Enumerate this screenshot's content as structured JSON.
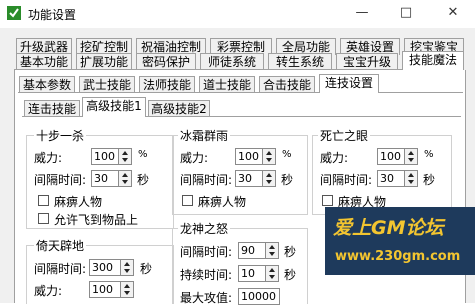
{
  "window": {
    "title": "功能设置",
    "minimize": "—",
    "maximize": "□",
    "close": "✕"
  },
  "tabs_row1": [
    "升级武器",
    "挖矿控制",
    "祝福油控制",
    "彩票控制",
    "全局功能",
    "英雄设置",
    "挖宝鉴宝"
  ],
  "tabs_row2": [
    "基本功能",
    "扩展功能",
    "密码保护",
    "师徒系统",
    "转生系统",
    "宝宝升级",
    "技能魔法"
  ],
  "tabs_row3": [
    "基本参数",
    "武士技能",
    "法师技能",
    "道士技能",
    "合击技能",
    "连技设置"
  ],
  "tabs_row4": [
    "连击技能",
    "高级技能1",
    "高级技能2"
  ],
  "groups": {
    "shibu": {
      "title": "十步一杀",
      "power_label": "威力:",
      "power": "100",
      "power_unit": "%",
      "interval_label": "间隔时间:",
      "interval": "30",
      "interval_unit": "秒",
      "paralyze": "麻痹人物",
      "fly": "允许飞到物品上"
    },
    "bingshuang": {
      "title": "冰霜群雨",
      "power_label": "威力:",
      "power": "100",
      "power_unit": "%",
      "interval_label": "间隔时间:",
      "interval": "30",
      "interval_unit": "秒",
      "paralyze": "麻痹人物"
    },
    "siwang": {
      "title": "死亡之眼",
      "power_label": "威力:",
      "power": "100",
      "power_unit": "%",
      "interval_label": "间隔时间:",
      "interval": "30",
      "interval_unit": "秒",
      "paralyze": "麻痹人物"
    },
    "yitian": {
      "title": "倚天辟地",
      "interval_label": "间隔时间:",
      "interval": "300",
      "interval_unit": "秒",
      "power_label": "威力:",
      "power": "100"
    },
    "longshen": {
      "title": "龙神之怒",
      "interval_label": "间隔时间:",
      "interval": "90",
      "interval_unit": "秒",
      "duration_label": "持续时间:",
      "duration": "10",
      "duration_unit": "秒",
      "hp_label": "最大攻值:",
      "hp": "10000"
    }
  },
  "watermark": {
    "logo": "爱上GM论坛",
    "url": "www.230gm.com"
  }
}
